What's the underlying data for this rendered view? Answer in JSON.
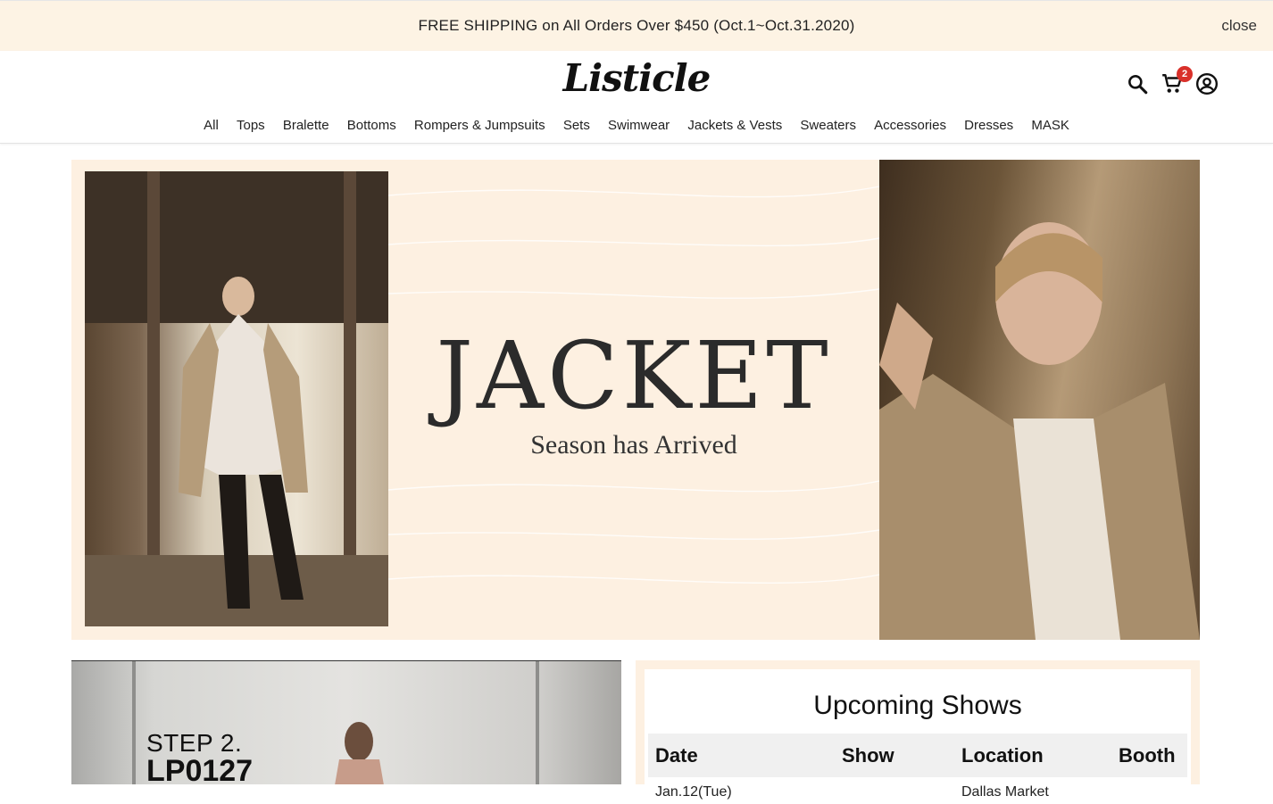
{
  "promo": {
    "text": "FREE SHIPPING on All Orders Over $450 (Oct.1~Oct.31.2020)",
    "close_label": "close"
  },
  "header": {
    "logo": "Listicle",
    "cart_count": "2",
    "icons": [
      "search-icon",
      "cart-icon",
      "account-icon"
    ]
  },
  "nav": {
    "items": [
      {
        "label": "All"
      },
      {
        "label": "Tops"
      },
      {
        "label": "Bralette"
      },
      {
        "label": "Bottoms"
      },
      {
        "label": "Rompers & Jumpsuits"
      },
      {
        "label": "Sets"
      },
      {
        "label": "Swimwear"
      },
      {
        "label": "Jackets & Vests"
      },
      {
        "label": "Sweaters"
      },
      {
        "label": "Accessories"
      },
      {
        "label": "Dresses"
      },
      {
        "label": "MASK"
      }
    ]
  },
  "hero": {
    "title": "JACKET",
    "subtitle": "Season has Arrived"
  },
  "step_banner": {
    "line1": "STEP 2.",
    "line2": "LP0127"
  },
  "shows": {
    "title": "Upcoming Shows",
    "columns": [
      "Date",
      "Show",
      "Location",
      "Booth"
    ],
    "rows": [
      {
        "date": "Jan.12(Tue)",
        "show": "",
        "location": "Dallas Market",
        "booth": ""
      }
    ]
  },
  "colors": {
    "promo_bg": "#fdf3e4",
    "hero_bg": "#fdf0e1",
    "badge": "#d9302a"
  }
}
